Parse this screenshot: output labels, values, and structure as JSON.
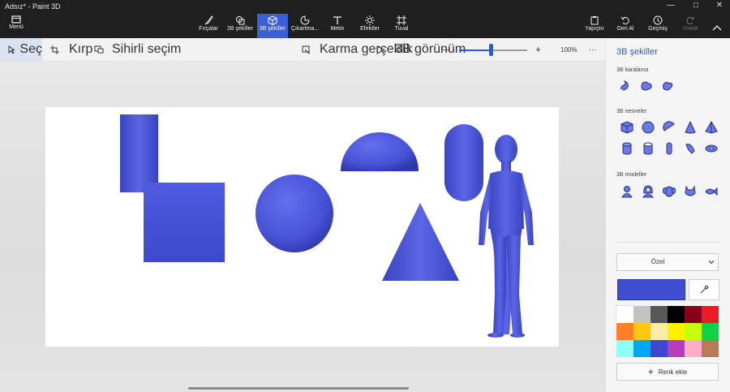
{
  "window": {
    "title": "Adsız* - Paint 3D",
    "minimize": "—",
    "maximize": "□",
    "close": "✕"
  },
  "ribbon": {
    "menu": "Menü",
    "tabs": [
      {
        "label": "Fırçalar",
        "icon": "brush-icon"
      },
      {
        "label": "2B şekiller",
        "icon": "shapes-2d-icon"
      },
      {
        "label": "3B şekiller",
        "icon": "cube-icon",
        "active": true
      },
      {
        "label": "Çıkartma...",
        "icon": "sticker-icon"
      },
      {
        "label": "Metin",
        "icon": "text-icon"
      },
      {
        "label": "Efektler",
        "icon": "effects-icon"
      },
      {
        "label": "Tuval",
        "icon": "canvas-icon"
      }
    ],
    "paste": "Yapıştır",
    "undo": "Geri Al",
    "history": "Geçmiş",
    "redo": "Yinele",
    "collapse_icon": "chevron-up-icon"
  },
  "toolbar": {
    "select": "Seç",
    "crop": "Kırp",
    "magic_select": "Sihirli seçim",
    "mixed_reality": "Karma gerçeklik",
    "view_3d": "3B görünüm",
    "zoom_minus": "—",
    "zoom_plus": "+",
    "zoom_level": "100%",
    "zoom_fraction": 0.47,
    "more": "···"
  },
  "panel": {
    "title": "3B şekiller",
    "doodle_label": "3B karalama",
    "objects_label": "3B nesneler",
    "models_label": "3B modeller",
    "doodle_icons": [
      "sharp-doodle-icon",
      "soft-doodle-icon",
      "tube-doodle-icon"
    ],
    "object_icons": [
      "cube-icon",
      "sphere-icon",
      "hemisphere-icon",
      "cone-icon",
      "pyramid-icon",
      "cylinder-icon",
      "tube-icon",
      "capsule-icon",
      "cone-donut-icon",
      "donut-icon"
    ],
    "model_icons": [
      "man-icon",
      "woman-icon",
      "dog-icon",
      "cat-icon",
      "fish-icon"
    ],
    "dropdown_value": "Özel",
    "current_color": "#3f4dd0",
    "palette": [
      "#ffffff",
      "#c3c3c3",
      "#585858",
      "#000000",
      "#88001b",
      "#ec1c24",
      "#ff7f27",
      "#ffc90e",
      "#fdeca6",
      "#fff200",
      "#c4ff0e",
      "#0ed145",
      "#8cfffb",
      "#00a8f3",
      "#3f48cc",
      "#b83dba",
      "#ffaec8",
      "#b97a56"
    ],
    "add_color": "Renk ekle"
  }
}
